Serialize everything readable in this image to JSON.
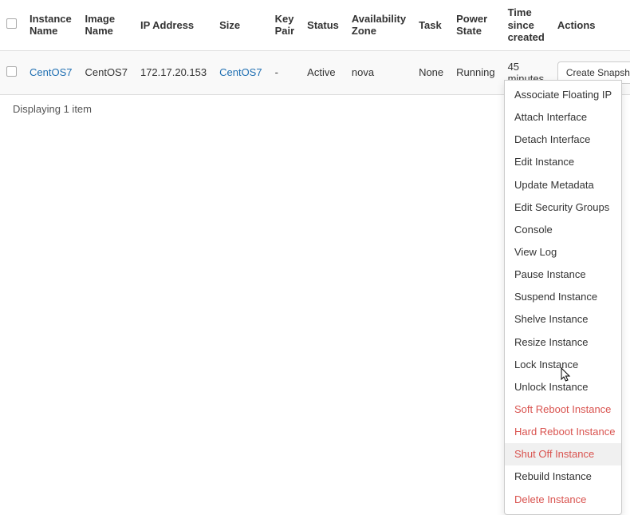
{
  "table": {
    "headers": {
      "instance_name": "Instance Name",
      "image_name": "Image Name",
      "ip_address": "IP Address",
      "size": "Size",
      "key_pair": "Key Pair",
      "status": "Status",
      "availability_zone": "Availability Zone",
      "task": "Task",
      "power_state": "Power State",
      "time_since_created": "Time since created",
      "actions": "Actions"
    },
    "rows": [
      {
        "instance_name": "CentOS7",
        "image_name": "CentOS7",
        "ip_address": "172.17.20.153",
        "size": "CentOS7",
        "key_pair": "-",
        "status": "Active",
        "availability_zone": "nova",
        "task": "None",
        "power_state": "Running",
        "time_since_created": "45 minutes",
        "action_button": "Create Snapshot"
      }
    ]
  },
  "footer": "Displaying 1 item",
  "dropdown": {
    "items": [
      {
        "label": "Associate Floating IP",
        "danger": false
      },
      {
        "label": "Attach Interface",
        "danger": false
      },
      {
        "label": "Detach Interface",
        "danger": false
      },
      {
        "label": "Edit Instance",
        "danger": false
      },
      {
        "label": "Update Metadata",
        "danger": false
      },
      {
        "label": "Edit Security Groups",
        "danger": false
      },
      {
        "label": "Console",
        "danger": false
      },
      {
        "label": "View Log",
        "danger": false
      },
      {
        "label": "Pause Instance",
        "danger": false
      },
      {
        "label": "Suspend Instance",
        "danger": false
      },
      {
        "label": "Shelve Instance",
        "danger": false
      },
      {
        "label": "Resize Instance",
        "danger": false
      },
      {
        "label": "Lock Instance",
        "danger": false
      },
      {
        "label": "Unlock Instance",
        "danger": false
      },
      {
        "label": "Soft Reboot Instance",
        "danger": true
      },
      {
        "label": "Hard Reboot Instance",
        "danger": true
      },
      {
        "label": "Shut Off Instance",
        "danger": true,
        "hover": true
      },
      {
        "label": "Rebuild Instance",
        "danger": false
      },
      {
        "label": "Delete Instance",
        "danger": true
      }
    ]
  }
}
